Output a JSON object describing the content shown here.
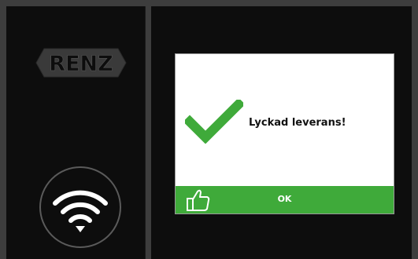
{
  "brand": {
    "name": "RENZ",
    "logo_fill": "#3a3a3a",
    "logo_text": "#0d0d0d"
  },
  "icons": {
    "wifi": "wifi-icon",
    "check": "checkmark-icon",
    "thumb": "thumbs-up-icon"
  },
  "dialog": {
    "message": "Lyckad leverans!",
    "ok_label": "OK"
  },
  "colors": {
    "accent_green": "#3faa3a",
    "panel_bg": "#0d0d0d",
    "frame": "#3d3d3d"
  }
}
